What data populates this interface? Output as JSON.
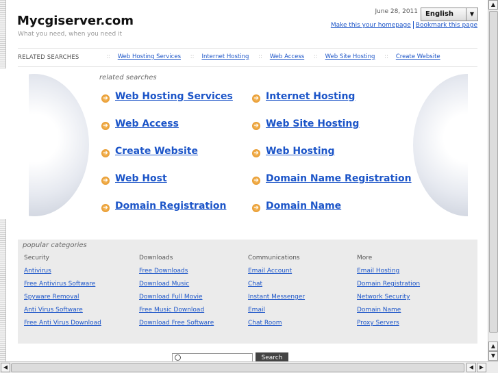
{
  "header": {
    "site_title": "Mycgiserver.com",
    "tagline": "What you need, when you need it",
    "date": "June 28, 2011",
    "language": "English",
    "links": [
      "Make this your homepage",
      "Bookmark this page"
    ]
  },
  "related_bar": {
    "label": "RELATED SEARCHES",
    "separator": "::",
    "items": [
      "Web Hosting Services",
      "Internet Hosting",
      "Web Access",
      "Web Site Hosting",
      "Create Website"
    ]
  },
  "related_searches": {
    "title": "related searches",
    "items": [
      "Web Hosting Services",
      "Internet Hosting",
      "Web Access",
      "Web Site Hosting",
      "Create Website",
      "Web Hosting",
      "Web Host",
      "Domain Name Registration",
      "Domain Registration",
      "Domain Name"
    ]
  },
  "popular": {
    "title": "popular categories",
    "columns": [
      {
        "head": "Security",
        "links": [
          "Antivirus",
          "Free Antivirus Software",
          "Spyware Removal",
          "Anti Virus Software",
          "Free Anti Virus Download"
        ]
      },
      {
        "head": "Downloads",
        "links": [
          "Free Downloads",
          "Download Music",
          "Download Full Movie",
          "Free Music Download",
          "Download Free Software"
        ]
      },
      {
        "head": "Communications",
        "links": [
          "Email Account",
          "Chat",
          "Instant Messenger",
          "Email",
          "Chat Room"
        ]
      },
      {
        "head": "More",
        "links": [
          "Email Hosting",
          "Domain Registration",
          "Network Security",
          "Domain Name",
          "Proxy Servers"
        ]
      }
    ]
  },
  "search": {
    "placeholder": "",
    "button": "Search"
  },
  "icons": {
    "bullet": "arrow-circle-icon",
    "language_dropdown": "chevron-down-icon",
    "search": "magnifier-icon"
  },
  "colors": {
    "link": "#1c55c8",
    "bullet": "#e08914",
    "popular_bg": "#ebebeb"
  }
}
